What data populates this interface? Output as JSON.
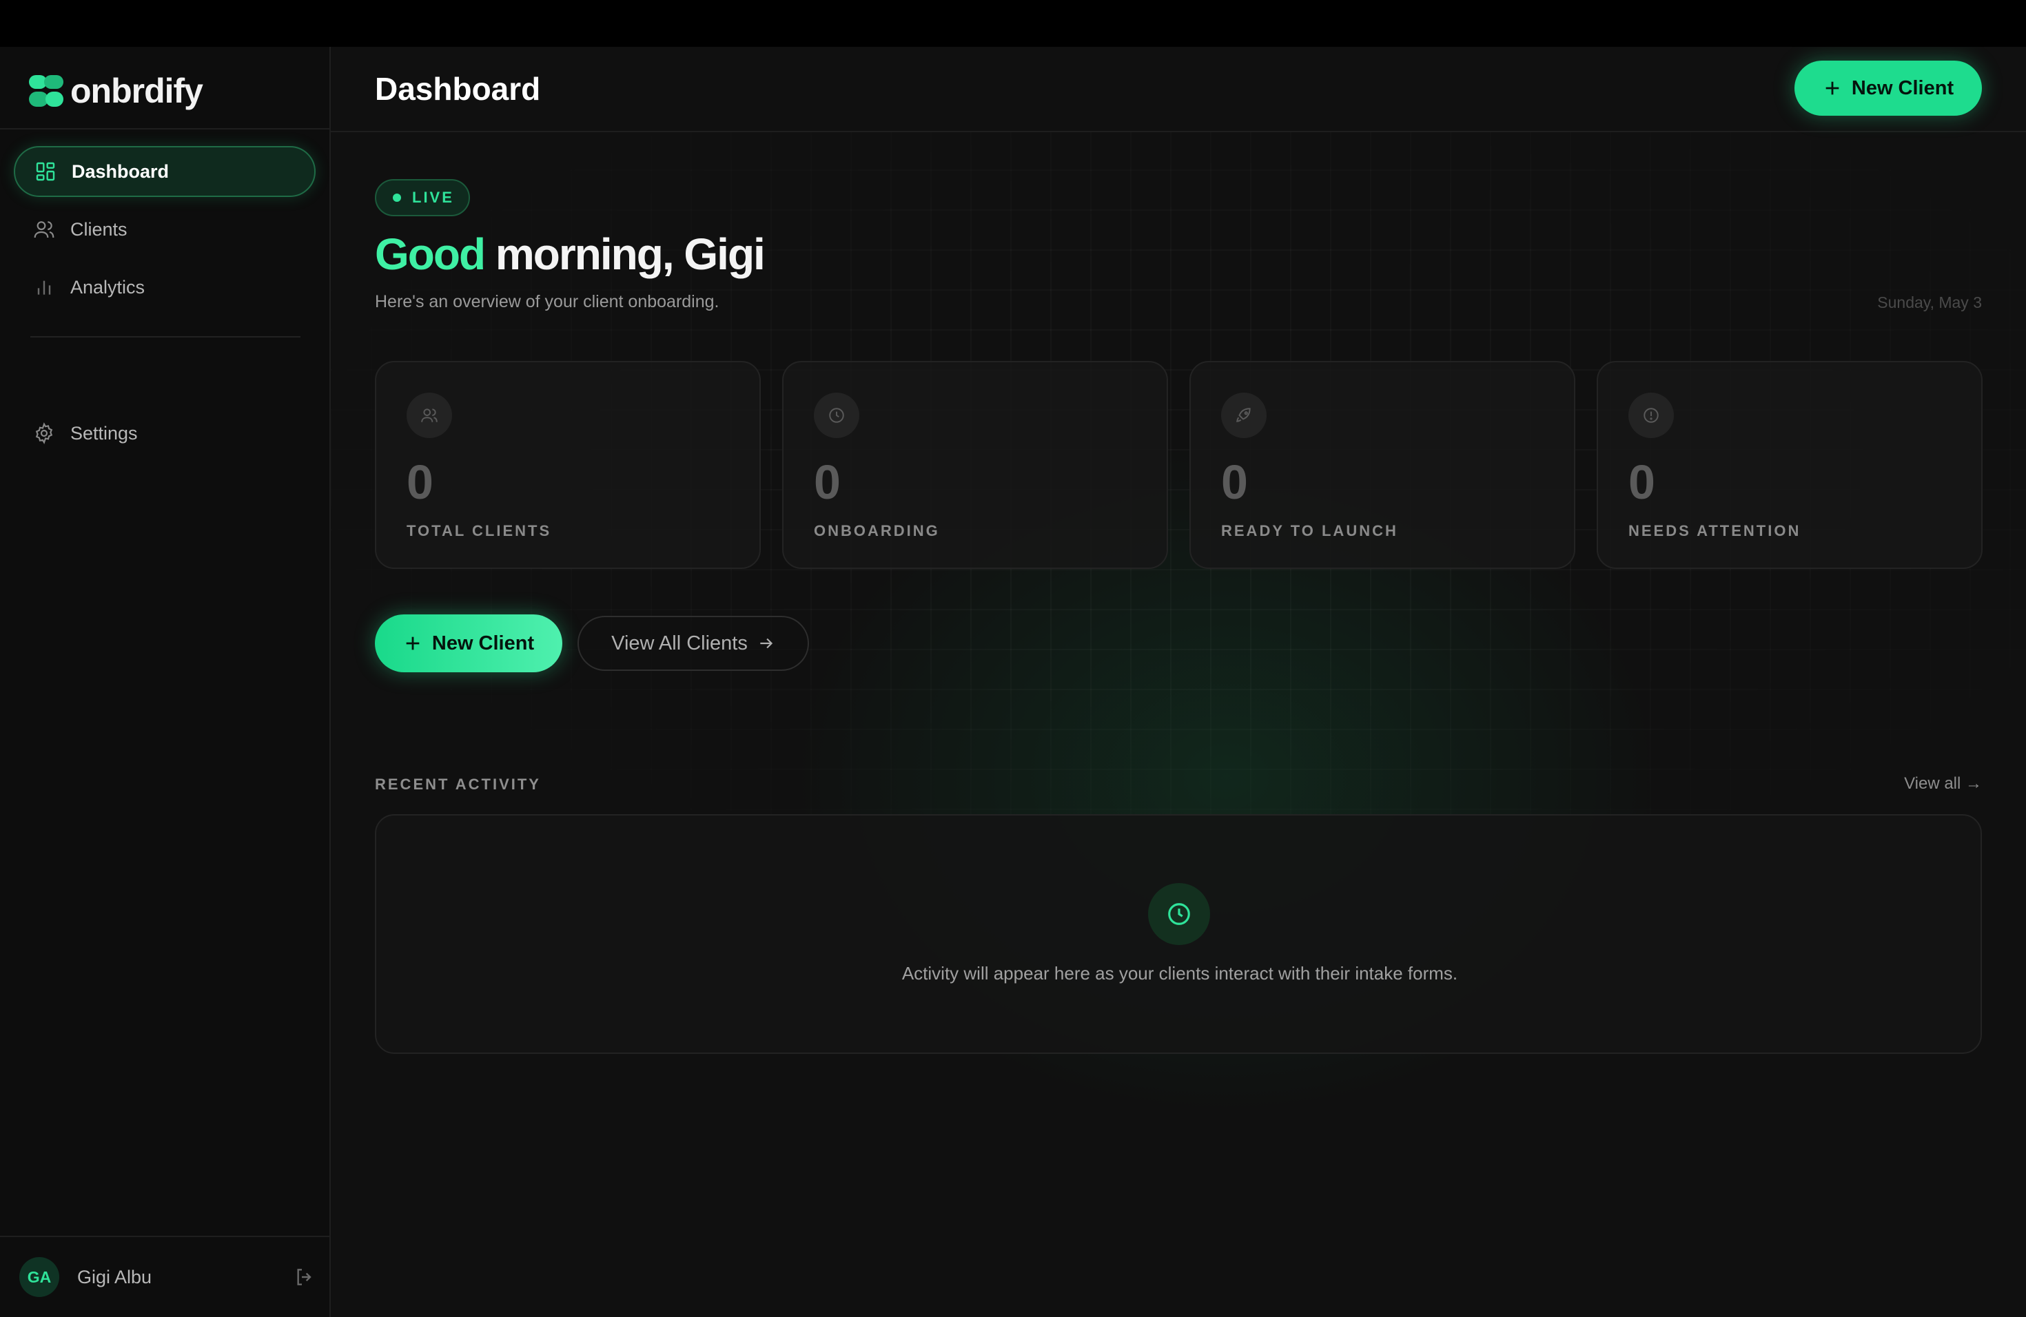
{
  "brand": {
    "name": "onbrdify",
    "accent": "#2fe39a"
  },
  "sidebar": {
    "items": [
      {
        "label": "Dashboard",
        "icon": "grid-icon",
        "active": true
      },
      {
        "label": "Clients",
        "icon": "users-icon",
        "active": false
      },
      {
        "label": "Analytics",
        "icon": "bar-chart-icon",
        "active": false
      },
      {
        "label": "Settings",
        "icon": "gear-icon",
        "active": false
      }
    ],
    "user": {
      "initials": "GA",
      "name": "Gigi Albu"
    }
  },
  "header": {
    "title": "Dashboard",
    "new_client_label": "New Client"
  },
  "hero": {
    "live_label": "LIVE",
    "greeting_accent": "Good",
    "greeting_rest": " morning, Gigi",
    "subtitle": "Here's an overview of your client onboarding.",
    "date": "Sunday, May 3"
  },
  "stats": [
    {
      "value": "0",
      "label": "TOTAL CLIENTS",
      "icon": "users-icon"
    },
    {
      "value": "0",
      "label": "ONBOARDING",
      "icon": "clock-icon"
    },
    {
      "value": "0",
      "label": "READY TO LAUNCH",
      "icon": "rocket-icon"
    },
    {
      "value": "0",
      "label": "NEEDS ATTENTION",
      "icon": "alert-icon"
    }
  ],
  "actions": {
    "new_client_label": "New Client",
    "view_all_clients_label": "View All Clients"
  },
  "recent_activity": {
    "title": "RECENT ACTIVITY",
    "view_all_label": "View all →",
    "empty_message": "Activity will appear here as your clients interact with their intake forms."
  }
}
